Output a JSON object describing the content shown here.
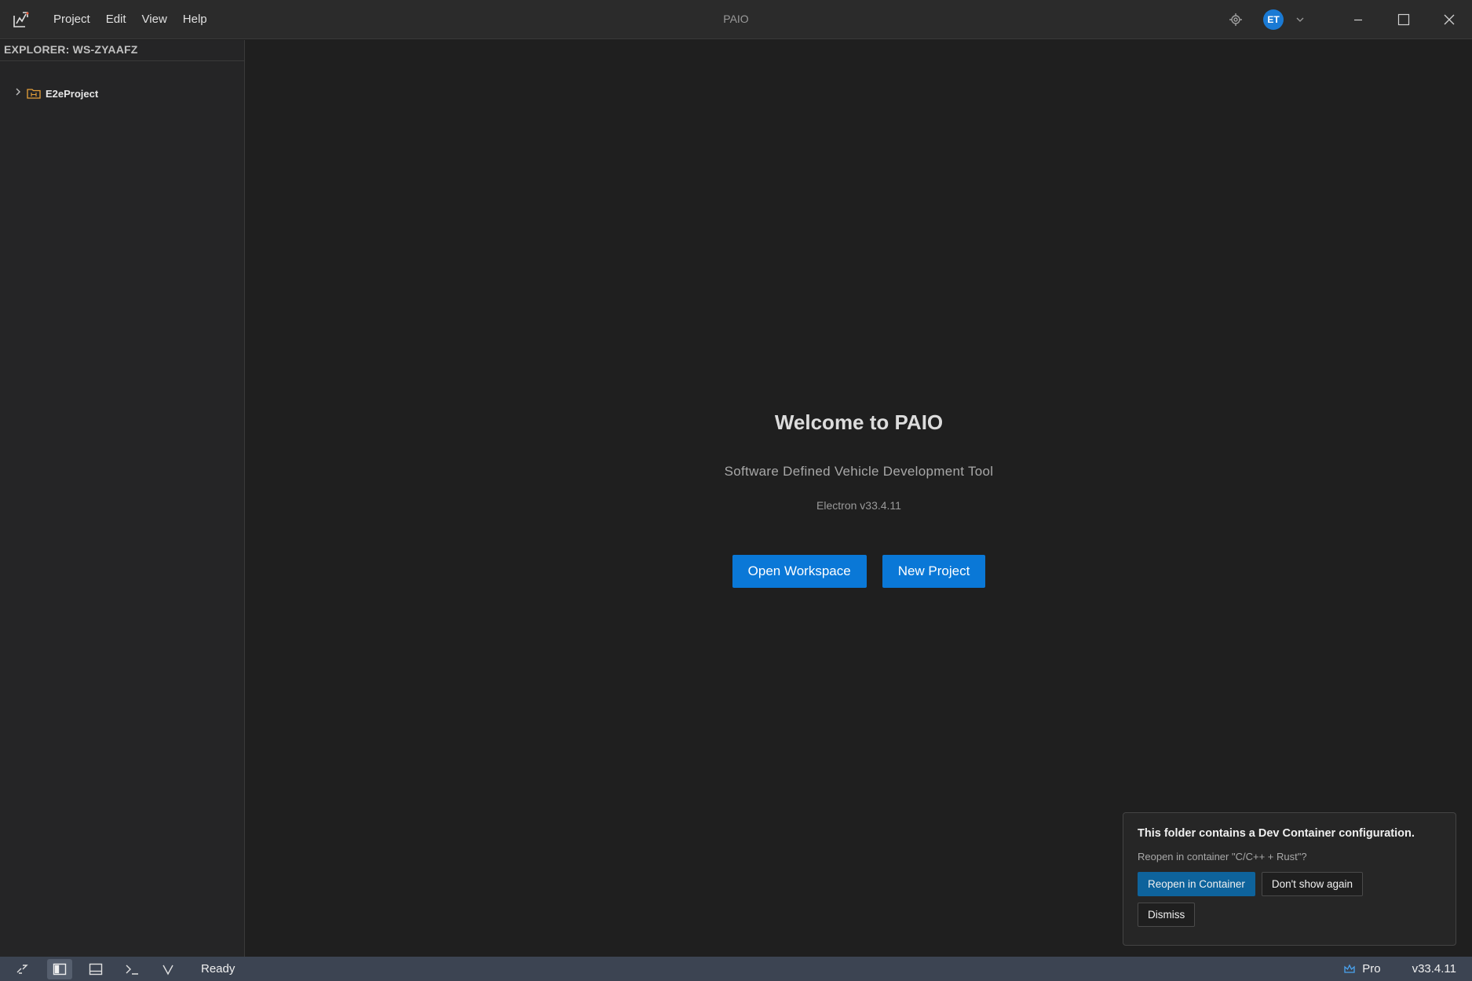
{
  "app": {
    "window_title": "PAIO",
    "logo_icon": "paio-logo-icon",
    "user_initials": "ET"
  },
  "menu": {
    "items": [
      {
        "label": "Project"
      },
      {
        "label": "Edit"
      },
      {
        "label": "View"
      },
      {
        "label": "Help"
      }
    ]
  },
  "explorer": {
    "header": "EXPLORER: WS-ZYAAFZ",
    "items": [
      {
        "label": "E2eProject",
        "icon": "folder-icon",
        "expanded": false
      }
    ]
  },
  "welcome": {
    "title": "Welcome to PAIO",
    "subtitle": "Software Defined Vehicle Development Tool",
    "version": "Electron v33.4.11",
    "open_workspace_label": "Open Workspace",
    "new_project_label": "New Project"
  },
  "notification": {
    "title": "This folder contains a Dev Container configuration.",
    "message": "Reopen in container \"C/C++ + Rust\"?",
    "reopen_label": "Reopen in Container",
    "dont_show_label": "Don't show again",
    "dismiss_label": "Dismiss"
  },
  "statusbar": {
    "status": "Ready",
    "plan": "Pro",
    "version": "v33.4.11"
  },
  "colors": {
    "accent": "#0a78d7",
    "statusbar_bg": "#3c4452",
    "titlebar_bg": "#2b2b2b",
    "sidebar_bg": "#252526",
    "editor_bg": "#1f1f1f"
  }
}
